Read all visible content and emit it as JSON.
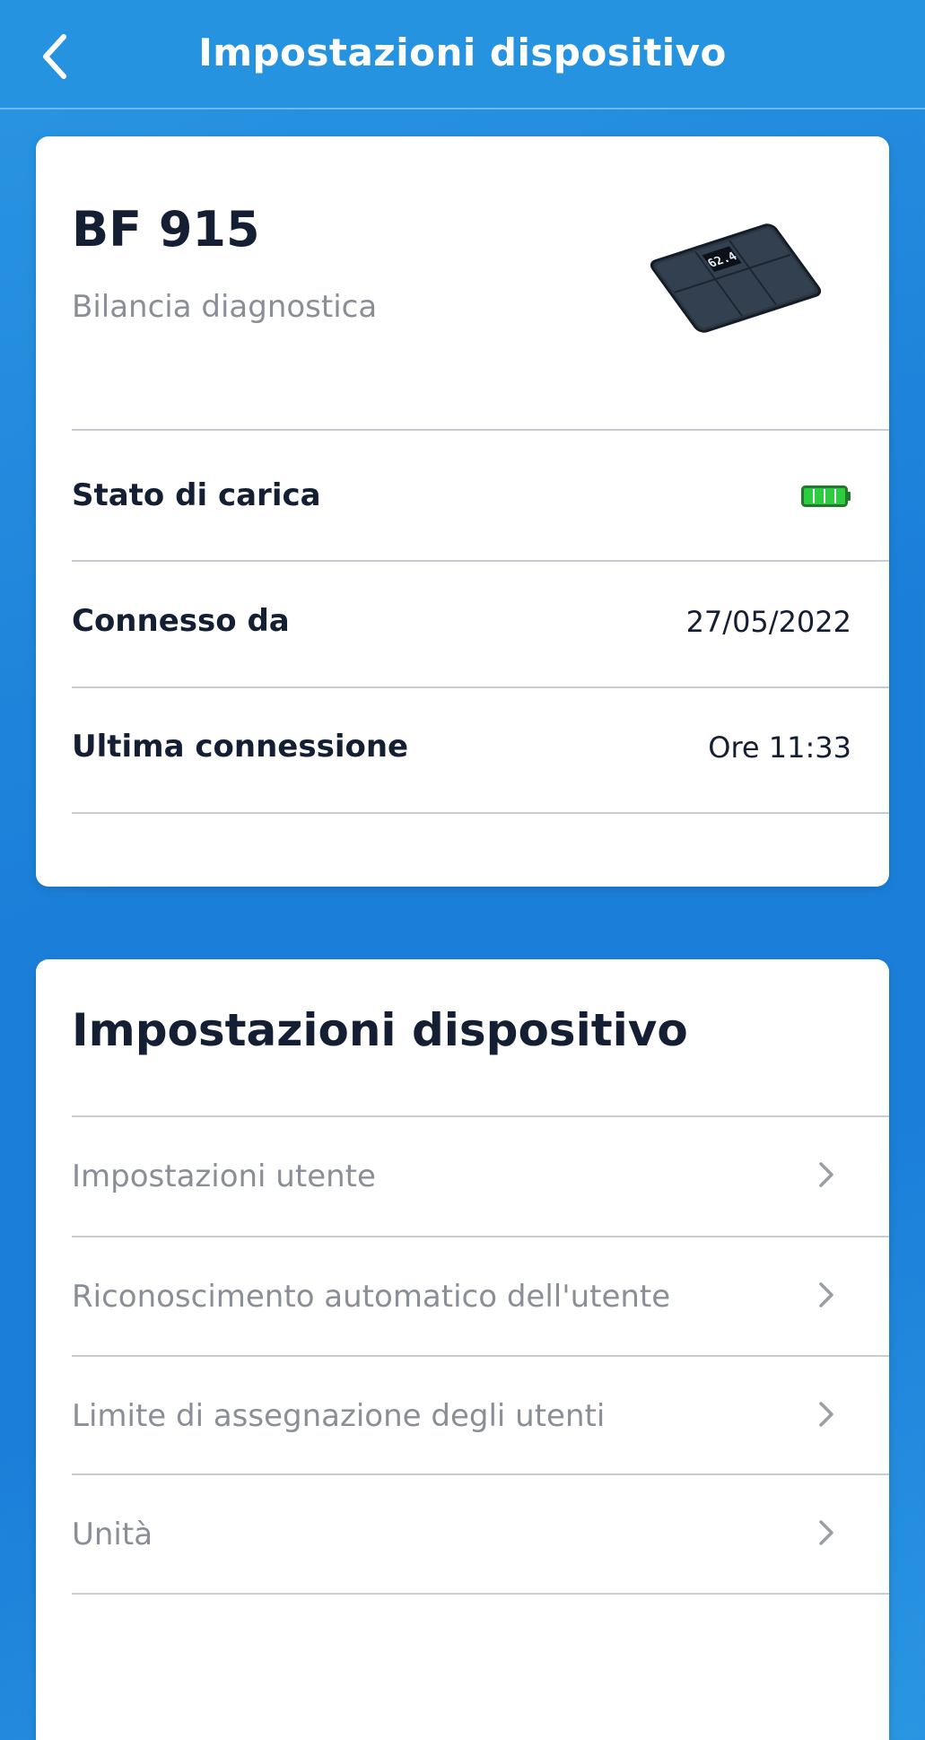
{
  "header": {
    "title": "Impostazioni dispositivo",
    "back_icon": "chevron-left-icon"
  },
  "device": {
    "name": "BF 915",
    "type": "Bilancia diagnostica",
    "image": "scale-icon",
    "screen_reading": "62.4",
    "rows": [
      {
        "label": "Stato di carica",
        "value": "",
        "icon": "battery-full-icon",
        "battery_level": 1.0,
        "battery_color": "#2ecc40"
      },
      {
        "label": "Connesso da",
        "value": "27/05/2022"
      },
      {
        "label": "Ultima connessione",
        "value": "Ore 11:33"
      }
    ]
  },
  "settings": {
    "title": "Impostazioni dispositivo",
    "items": [
      {
        "label": "Impostazioni utente",
        "icon": "chevron-right-icon"
      },
      {
        "label": "Riconoscimento automatico dell'utente",
        "icon": "chevron-right-icon"
      },
      {
        "label": "Limite di assegnazione degli utenti",
        "icon": "chevron-right-icon"
      },
      {
        "label": "Unità",
        "icon": "chevron-right-icon"
      }
    ]
  },
  "colors": {
    "header": "#2693e0",
    "background": "#1b7fd9",
    "card": "#ffffff",
    "text_primary": "#141f33",
    "text_secondary": "#8a8f97",
    "battery": "#2ecc40"
  }
}
